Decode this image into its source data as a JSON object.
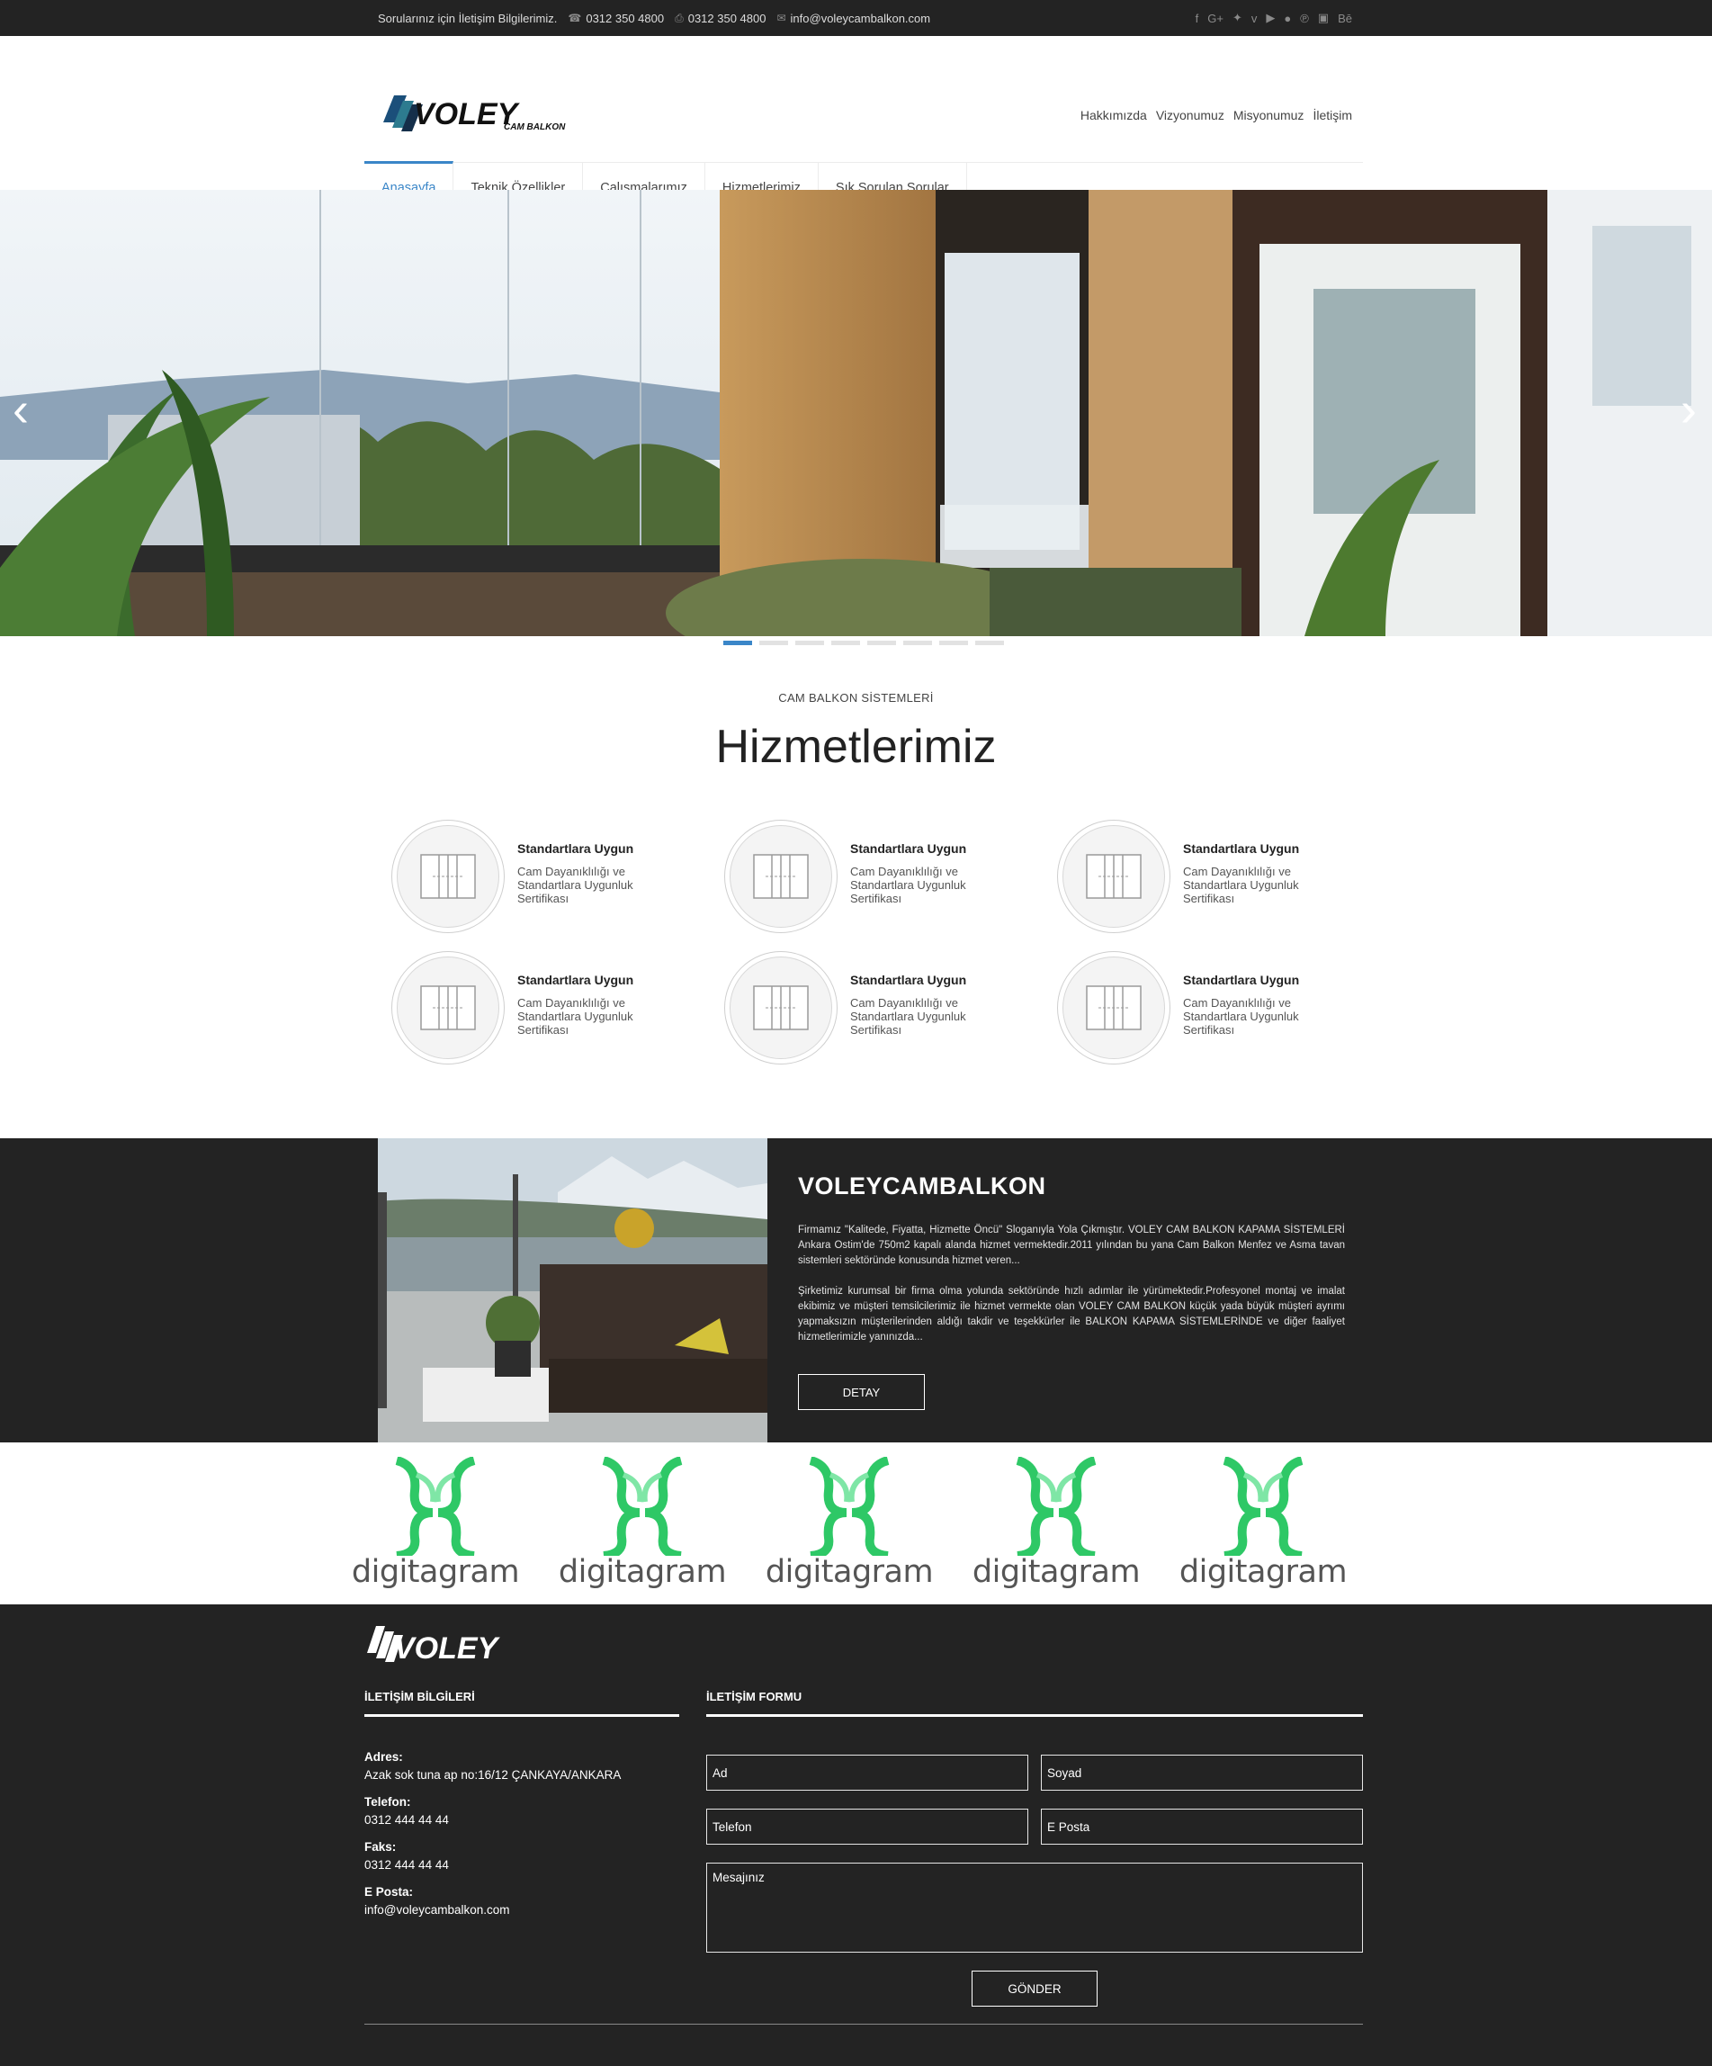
{
  "topbar": {
    "question": "Sorularınız için İletişim Bilgilerimiz.",
    "phone": "0312 350 4800",
    "fax": "0312 350 4800",
    "email": "info@voleycambalkon.com",
    "social_icons": [
      "facebook-icon",
      "google-plus-icon",
      "twitter-icon",
      "vimeo-icon",
      "youtube-icon",
      "flickr-icon",
      "pinterest-icon",
      "instagram-icon",
      "behance-icon"
    ],
    "behance_label": "Bē"
  },
  "logo": {
    "brand": "VOLEY",
    "sub": "CAM BALKON"
  },
  "topnav": [
    "Hakkımızda",
    "Vizyonumuz",
    "Misyonumuz",
    "İletişim"
  ],
  "mainnav": [
    "Anasayfa",
    "Teknik Özellikler",
    "Çalışmalarımız",
    "Hizmetlerimiz",
    "Sık Sorulan Sorular"
  ],
  "slider": {
    "active_dot": 0,
    "dot_count": 8
  },
  "services": {
    "subtitle": "CAM BALKON SİSTEMLERİ",
    "title": "Hizmetlerimiz",
    "items": [
      {
        "title": "Standartlara Uygun",
        "desc": "Cam Dayanıklılığı ve Standartlara Uygunluk Sertifikası"
      },
      {
        "title": "Standartlara Uygun",
        "desc": "Cam Dayanıklılığı ve Standartlara Uygunluk Sertifikası"
      },
      {
        "title": "Standartlara Uygun",
        "desc": "Cam Dayanıklılığı ve Standartlara Uygunluk Sertifikası"
      },
      {
        "title": "Standartlara Uygun",
        "desc": "Cam Dayanıklılığı ve Standartlara Uygunluk Sertifikası"
      },
      {
        "title": "Standartlara Uygun",
        "desc": "Cam Dayanıklılığı ve Standartlara Uygunluk Sertifikası"
      },
      {
        "title": "Standartlara Uygun",
        "desc": "Cam Dayanıklılığı ve Standartlara Uygunluk Sertifikası"
      }
    ]
  },
  "about": {
    "title": "VOLEYCAMBALKON",
    "p1": "Firmamız \"Kalitede, Fiyatta, Hizmette Öncü\" Sloganıyla Yola Çıkmıştır. VOLEY CAM BALKON KAPAMA SİSTEMLERİ Ankara Ostim'de 750m2 kapalı alanda hizmet vermektedir.2011 yılından bu yana Cam Balkon Menfez ve Asma tavan sistemleri sektöründe konusunda hizmet veren...",
    "p2": "Şirketimiz kurumsal bir firma olma yolunda sektöründe hızlı adımlar ile yürümektedir.Profesyonel montaj ve imalat ekibimiz ve müşteri temsilcilerimiz ile hizmet vermekte olan VOLEY CAM BALKON küçük yada büyük müşteri ayrımı yapmaksızın müşterilerinden aldığı takdir ve teşekkürler ile BALKON KAPAMA SİSTEMLERİNDE ve diğer faaliyet hizmetlerimizle yanınızda...",
    "button": "DETAY"
  },
  "partners": [
    {
      "name": "digitagram"
    },
    {
      "name": "digitagram"
    },
    {
      "name": "digitagram"
    },
    {
      "name": "digitagram"
    },
    {
      "name": "digitagram"
    }
  ],
  "footer": {
    "brand": "VOLEY",
    "contact_heading": "İLETİŞİM BİLGİLERİ",
    "form_heading": "İLETİŞİM FORMU",
    "address_label": "Adres:",
    "address": "Azak sok tuna ap no:16/12 ÇANKAYA/ANKARA",
    "phone_label": "Telefon:",
    "phone": "0312 444 44 44",
    "fax_label": "Faks:",
    "fax": "0312 444 44 44",
    "email_label": "E Posta:",
    "email": "info@voleycambalkon.com",
    "form": {
      "first_name": "Ad",
      "last_name": "Soyad",
      "phone": "Telefon",
      "email": "E Posta",
      "message": "Mesajınız",
      "submit": "GÖNDER"
    }
  },
  "colors": {
    "dark": "#232323",
    "accent": "#3a86c8",
    "partner_green": "#2ec866"
  }
}
